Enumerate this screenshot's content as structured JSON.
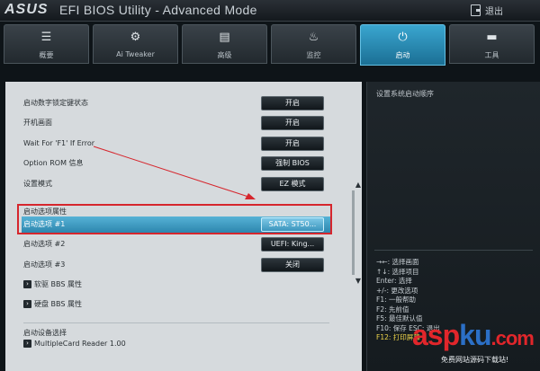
{
  "header": {
    "logo": "ASUS",
    "title": "EFI BIOS Utility - Advanced Mode",
    "exit_label": "退出"
  },
  "tabs": [
    {
      "label": "概要",
      "icon": "list-icon"
    },
    {
      "label": "Ai Tweaker",
      "icon": "tweaker-icon"
    },
    {
      "label": "高级",
      "icon": "advanced-icon"
    },
    {
      "label": "监控",
      "icon": "monitor-icon"
    },
    {
      "label": "启动",
      "icon": "power-icon",
      "active": true
    },
    {
      "label": "工具",
      "icon": "tool-icon"
    }
  ],
  "main": {
    "rows": [
      {
        "label": "启动数字锁定键状态",
        "value": "开启"
      },
      {
        "label": "开机画面",
        "value": "开启"
      },
      {
        "label": "Wait For 'F1' If Error",
        "value": "开启"
      },
      {
        "label": "Option ROM 信息",
        "value": "强制 BIOS"
      },
      {
        "label": "设置模式",
        "value": "EZ 模式"
      }
    ],
    "boot_section_title": "启动选项属性",
    "boot_options": [
      {
        "label": "启动选项 #1",
        "value": "SATA: ST50...",
        "selected": true
      },
      {
        "label": "启动选项 #2",
        "value": "UEFI: King..."
      },
      {
        "label": "启动选项 #3",
        "value": "关闭"
      }
    ],
    "submenus": [
      "软驱 BBS 属性",
      "硬盘 BBS 属性"
    ],
    "device_section_title": "启动设备选择",
    "device_items": [
      "MultipleCard Reader 1.00"
    ]
  },
  "help": {
    "description": "设置系统启动顺序",
    "keys": [
      "→←: 选择画面",
      "↑↓: 选择项目",
      "Enter: 选择",
      "+/-: 更改选项",
      "F1: 一般帮助",
      "F2: 先前值",
      "F5: 最佳默认值",
      "F10: 保存 ESC: 退出",
      "F12: 打印屏幕"
    ]
  },
  "watermark": {
    "brand_a": "asp",
    "brand_b": "ku",
    "brand_c": ".com",
    "tagline": "免费网站源码下载站!"
  },
  "colors": {
    "accent": "#2d86ae",
    "highlight_box": "#d6262d"
  }
}
